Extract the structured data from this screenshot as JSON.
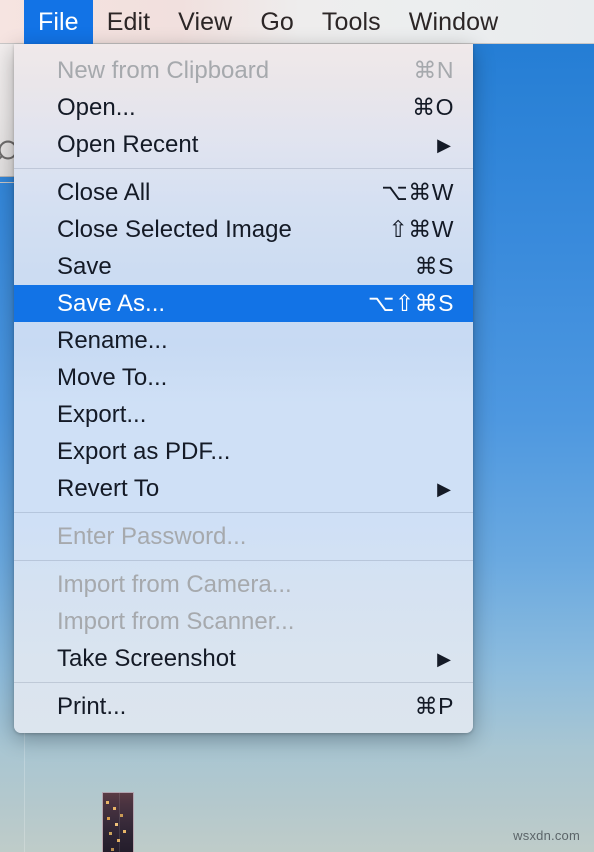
{
  "menubar": {
    "items": [
      {
        "label": "File",
        "active": true
      },
      {
        "label": "Edit",
        "active": false
      },
      {
        "label": "View",
        "active": false
      },
      {
        "label": "Go",
        "active": false
      },
      {
        "label": "Tools",
        "active": false
      },
      {
        "label": "Window",
        "active": false
      }
    ]
  },
  "background": {
    "search_icon": "search-icon",
    "thumbnail": "image-thumbnail"
  },
  "file_menu": {
    "title": "File",
    "groups": [
      {
        "items": [
          {
            "label": "New from Clipboard",
            "shortcut": "⌘N",
            "submenu": false,
            "disabled": true,
            "selected": false
          },
          {
            "label": "Open...",
            "shortcut": "⌘O",
            "submenu": false,
            "disabled": false,
            "selected": false
          },
          {
            "label": "Open Recent",
            "shortcut": "",
            "submenu": true,
            "disabled": false,
            "selected": false
          }
        ]
      },
      {
        "items": [
          {
            "label": "Close All",
            "shortcut": "⌥⌘W",
            "submenu": false,
            "disabled": false,
            "selected": false
          },
          {
            "label": "Close Selected Image",
            "shortcut": "⇧⌘W",
            "submenu": false,
            "disabled": false,
            "selected": false
          },
          {
            "label": "Save",
            "shortcut": "⌘S",
            "submenu": false,
            "disabled": false,
            "selected": false
          },
          {
            "label": "Save As...",
            "shortcut": "⌥⇧⌘S",
            "submenu": false,
            "disabled": false,
            "selected": true
          },
          {
            "label": "Rename...",
            "shortcut": "",
            "submenu": false,
            "disabled": false,
            "selected": false
          },
          {
            "label": "Move To...",
            "shortcut": "",
            "submenu": false,
            "disabled": false,
            "selected": false
          },
          {
            "label": "Export...",
            "shortcut": "",
            "submenu": false,
            "disabled": false,
            "selected": false
          },
          {
            "label": "Export as PDF...",
            "shortcut": "",
            "submenu": false,
            "disabled": false,
            "selected": false
          },
          {
            "label": "Revert To",
            "shortcut": "",
            "submenu": true,
            "disabled": false,
            "selected": false
          }
        ]
      },
      {
        "items": [
          {
            "label": "Enter Password...",
            "shortcut": "",
            "submenu": false,
            "disabled": true,
            "selected": false
          }
        ]
      },
      {
        "items": [
          {
            "label": "Import from Camera...",
            "shortcut": "",
            "submenu": false,
            "disabled": true,
            "selected": false
          },
          {
            "label": "Import from Scanner...",
            "shortcut": "",
            "submenu": false,
            "disabled": true,
            "selected": false
          },
          {
            "label": "Take Screenshot",
            "shortcut": "",
            "submenu": true,
            "disabled": false,
            "selected": false
          }
        ]
      },
      {
        "items": [
          {
            "label": "Print...",
            "shortcut": "⌘P",
            "submenu": false,
            "disabled": false,
            "selected": false
          }
        ]
      }
    ],
    "submenu_arrow_glyph": "▶"
  },
  "watermark": {
    "text": "wsxdn.com"
  },
  "colors": {
    "accent": "#1273e6",
    "menu_text": "#141a26",
    "disabled_text": "#a6a9ad",
    "selected_text": "#ffffff",
    "desktop_blue": "#3a8bdc"
  }
}
